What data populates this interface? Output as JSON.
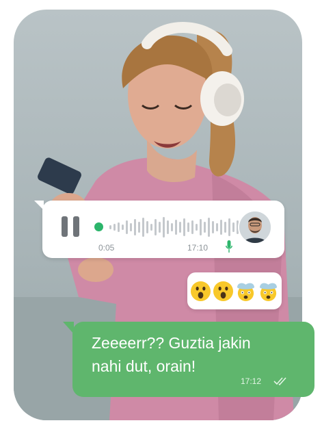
{
  "voice_message": {
    "duration": "0:05",
    "timestamp": "17:10"
  },
  "reactions": [
    "😮",
    "😮",
    "😱",
    "😱"
  ],
  "outgoing_message": {
    "text_line1": "Zeeeerr?? Guztia jakin",
    "text_line2": "nahi dut, orain!",
    "timestamp": "17:12"
  },
  "colors": {
    "accent_green": "#2cb56b",
    "bubble_green": "#5fb66d",
    "waveform_gray": "#c4c8cc"
  }
}
